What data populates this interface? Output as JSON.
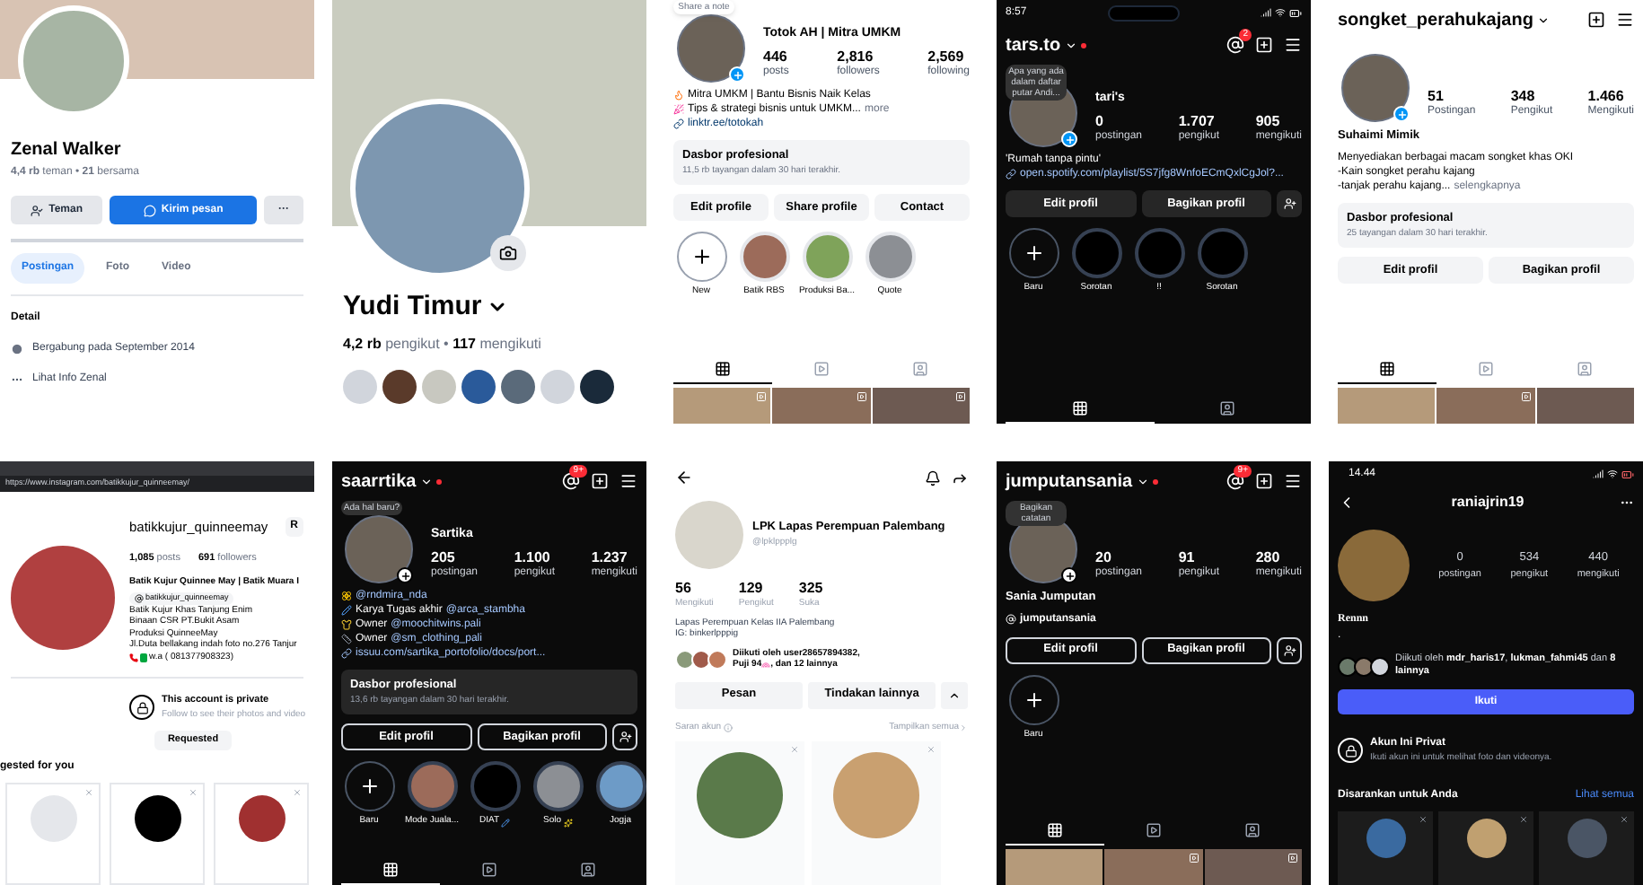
{
  "panels": [
    {
      "kind": "fb_profile",
      "name": "Zenal Walker",
      "stats": "**4,4 rb** teman • **21** bersama",
      "buttons": [
        {
          "kind": "friend",
          "label": "Teman"
        },
        {
          "kind": "message",
          "label": "Kirim pesan"
        },
        {
          "kind": "more",
          "label": "···"
        }
      ],
      "tabs": [
        {
          "label": "Postingan",
          "selected": true
        },
        {
          "label": "Foto",
          "selected": false
        },
        {
          "label": "Video",
          "selected": false
        }
      ],
      "detail_title": "Detail",
      "details": [
        {
          "kind": "clock",
          "text": "Bergabung pada September 2014"
        },
        {
          "kind": "more",
          "text": "Lihat Info Zenal"
        }
      ]
    },
    {
      "kind": "fb_cover",
      "name": "Yudi Timur",
      "stats": "**4,2 rb** pengikut • **117** mengikuti"
    },
    {
      "kind": "ig_light",
      "note": "Share a note",
      "title": "Totok AH | Mitra UMKM",
      "stats": [
        {
          "value": "446",
          "label": "posts"
        },
        {
          "value": "2,816",
          "label": "followers"
        },
        {
          "value": "2,569",
          "label": "following"
        }
      ],
      "bio": [
        {
          "kind": "flame",
          "text": "Mitra UMKM | Bantu Bisnis Naik Kelas"
        },
        {
          "kind": "party",
          "text": "Tips & strategi bisnis untuk UMKM..."
        }
      ],
      "more": "more",
      "link": "linktr.ee/totokah",
      "dashboard": {
        "title": "Dasbor profesional",
        "subtitle": "11,5 rb tayangan dalam 30 hari terakhir."
      },
      "buttons": [
        {
          "kind": "filled",
          "label": "Edit profile"
        },
        {
          "kind": "filled",
          "label": "Share profile"
        },
        {
          "kind": "filled",
          "label": "Contact"
        }
      ],
      "highlights": [
        {
          "kind": "new",
          "label": "New"
        },
        {
          "kind": "photo",
          "label": "Batik RBS"
        },
        {
          "kind": "photo",
          "label": "Produksi Ba..."
        },
        {
          "kind": "photo",
          "label": "Quote"
        }
      ],
      "tabs": [
        {
          "kind": "grid",
          "selected": true
        },
        {
          "kind": "reels",
          "selected": false
        },
        {
          "kind": "tagged",
          "selected": false
        }
      ],
      "posts": [
        {
          "video": true
        },
        {
          "video": true
        },
        {
          "video": true
        }
      ]
    },
    {
      "kind": "ig_dark",
      "time": "8:57",
      "username": "tars.to",
      "badge": "2",
      "note": "Apa yang ada dalam daftar putar Andi...",
      "title": "tari's",
      "stats": [
        {
          "value": "0",
          "label": "postingan"
        },
        {
          "value": "1.707",
          "label": "pengikut"
        },
        {
          "value": "905",
          "label": "mengikuti"
        }
      ],
      "bio": [
        {
          "text": "'Rumah tanpa pintu'"
        }
      ],
      "link": "open.spotify.com/playlist/5S7jfg8WnfoECmQxlCgJol?...",
      "buttons": [
        {
          "kind": "filled",
          "label": "Edit profil"
        },
        {
          "kind": "filled",
          "label": "Bagikan profil"
        }
      ],
      "highlights": [
        {
          "kind": "new",
          "label": "Baru"
        },
        {
          "kind": "dark",
          "label": "Sorotan"
        },
        {
          "kind": "dark",
          "label": "!!"
        },
        {
          "kind": "dark",
          "label": "Sorotan"
        }
      ],
      "tabs": [
        {
          "kind": "grid",
          "selected": true
        },
        {
          "kind": "tagged",
          "selected": false
        }
      ]
    },
    {
      "kind": "ig_light",
      "username": "songket_perahukajang",
      "stats": [
        {
          "value": "51",
          "label": "Postingan"
        },
        {
          "value": "348",
          "label": "Pengikut"
        },
        {
          "value": "1.466",
          "label": "Mengikuti"
        }
      ],
      "name": "Suhaimi Mimik",
      "bio": [
        {
          "text": "Menyediakan berbagai macam songket khas OKI"
        },
        {
          "text": "-Kain songket perahu kajang"
        },
        {
          "text": "-tanjak perahu kajang..."
        }
      ],
      "more": "selengkapnya",
      "dashboard": {
        "title": "Dasbor profesional",
        "subtitle": "25 tayangan dalam 30 hari terakhir."
      },
      "buttons": [
        {
          "kind": "filled",
          "label": "Edit profil"
        },
        {
          "kind": "filled",
          "label": "Bagikan profil"
        }
      ],
      "tabs": [
        {
          "kind": "grid",
          "selected": true
        },
        {
          "kind": "reels",
          "selected": false
        },
        {
          "kind": "tagged",
          "selected": false
        }
      ],
      "posts": [
        {
          "video": false
        },
        {
          "video": true
        },
        {
          "video": false
        }
      ]
    },
    {
      "kind": "web_profile",
      "url": "https://www.instagram.com/batikkujur_quinneemay/",
      "username": "batikkujur_quinneemay",
      "action": "R",
      "stats": [
        "**1,085** posts",
        "**691** followers"
      ],
      "bio_name": "Batik Kujur Quinnee May | Batik Muara I",
      "threads": "batikkujur_quinneemay",
      "bio": [
        "Batik Kujur Khas Tanjung Enim",
        "Binaan CSR PT.Bukit Asam",
        "Produksi QuinneeMay",
        "Jl.Duta bellakang indah foto no.276 Tanjur"
      ],
      "phone": "w.a ( 081377908323)",
      "private_title": "This account is private",
      "private_text": "Follow to see their photos and video",
      "request_button": "Requested",
      "suggested": "gested for you"
    },
    {
      "kind": "ig_dark",
      "username": "saarrtika",
      "badge": "9+",
      "note": "Ada hal baru?",
      "title": "Sartika",
      "stats": [
        {
          "value": "205",
          "label": "postingan"
        },
        {
          "value": "1.100",
          "label": "pengikut"
        },
        {
          "value": "1.237",
          "label": "mengikuti"
        }
      ],
      "bio": [
        {
          "kind": "flower",
          "mention": "@rndmira_nda"
        },
        {
          "kind": "pencil",
          "text": "Karya Tugas akhir",
          "mention": "@arca_stambha"
        },
        {
          "kind": "hat",
          "text": "Owner",
          "mention": "@moochitwins.pali"
        },
        {
          "kind": "ruler",
          "text": "Owner",
          "mention": "@sm_clothing_pali"
        }
      ],
      "link": "issuu.com/sartika_portofolio/docs/port...",
      "dashboard": {
        "title": "Dasbor profesional",
        "subtitle": "13,6 rb tayangan dalam 30 hari terakhir."
      },
      "buttons": [
        {
          "kind": "outline",
          "label": "Edit profil"
        },
        {
          "kind": "outline",
          "label": "Bagikan profil"
        }
      ],
      "highlights": [
        {
          "kind": "new",
          "label": "Baru"
        },
        {
          "kind": "photo",
          "label": "Mode Juala..."
        },
        {
          "kind": "pencil",
          "label": "DIAT"
        },
        {
          "kind": "sparkle",
          "label": "Solo"
        },
        {
          "kind": "photo",
          "label": "Jogja"
        }
      ],
      "tabs": [
        {
          "kind": "grid",
          "selected": true
        },
        {
          "kind": "reels",
          "selected": false
        },
        {
          "kind": "tagged",
          "selected": false
        }
      ]
    },
    {
      "kind": "tiktok_profile",
      "name": "LPK Lapas Perempuan Palembang",
      "handle": "@lpklppplg",
      "stats": [
        {
          "value": "56",
          "label": "Mengikuti"
        },
        {
          "value": "129",
          "label": "Pengikut"
        },
        {
          "value": "325",
          "label": "Suka"
        }
      ],
      "bio": [
        "Lapas Perempuan Kelas IIA Palembang",
        "IG: binkerlpppig"
      ],
      "followed": {
        "line1": "Diikuti oleh user28657894382,",
        "line2_before": "Puji 94",
        "line2_after": ", dan 12 lainnya"
      },
      "buttons": [
        "Pesan",
        "Tindakan lainnya"
      ],
      "suggest_title": "Saran akun",
      "see_all": "Tampilkan semua"
    },
    {
      "kind": "ig_dark",
      "username": "jumputansania",
      "badge": "9+",
      "note": "Bagikan catatan",
      "stats": [
        {
          "value": "20",
          "label": "postingan"
        },
        {
          "value": "91",
          "label": "pengikut"
        },
        {
          "value": "280",
          "label": "mengikuti"
        }
      ],
      "name": "Sania Jumputan",
      "threads": "jumputansania",
      "buttons": [
        {
          "kind": "outline",
          "label": "Edit profil"
        },
        {
          "kind": "outline",
          "label": "Bagikan profil"
        }
      ],
      "highlights": [
        {
          "kind": "new",
          "label": "Baru"
        }
      ],
      "tabs": [
        {
          "kind": "grid",
          "selected": true
        },
        {
          "kind": "reels",
          "selected": false
        },
        {
          "kind": "tagged",
          "selected": false
        }
      ],
      "posts": [
        {
          "video": false
        },
        {
          "video": true
        },
        {
          "video": true
        }
      ]
    },
    {
      "kind": "ig_private_dark",
      "time": "14.44",
      "username": "raniajrin19",
      "stats": [
        {
          "value": "0",
          "label": "postingan"
        },
        {
          "value": "534",
          "label": "pengikut"
        },
        {
          "value": "440",
          "label": "mengikuti"
        }
      ],
      "name": "Rennn",
      "bio": ".",
      "followed": "Diikuti oleh **mdr_haris17**, **lukman_fahmi45** dan **8 lainnya**",
      "follow_button": "Ikuti",
      "private_title": "Akun Ini Privat",
      "private_text": "Ikuti akun ini untuk melihat foto dan videonya.",
      "suggest_title": "Disarankan untuk Anda",
      "see_all": "Lihat semua"
    }
  ]
}
